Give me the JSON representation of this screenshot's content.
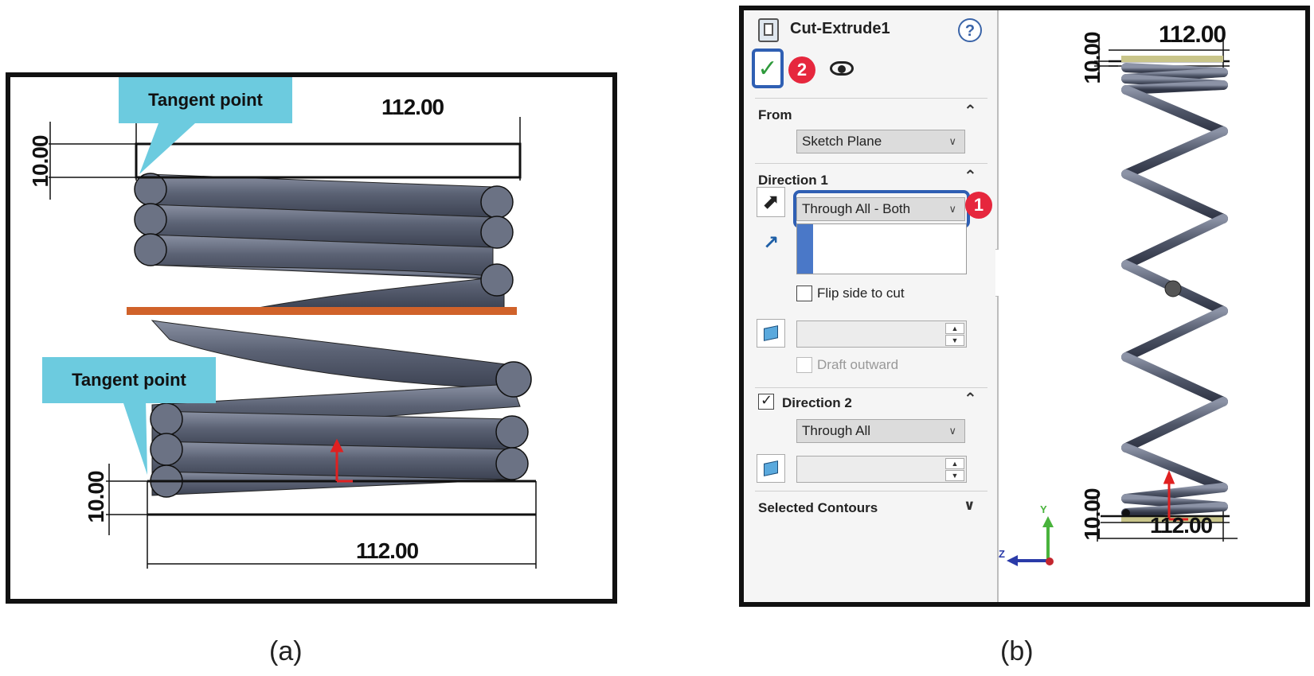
{
  "panel_a": {
    "callout_top": "Tangent point",
    "callout_bottom": "Tangent point",
    "dim_top_horizontal": "112.00",
    "dim_top_vertical": "10.00",
    "dim_bottom_horizontal": "112.00",
    "dim_bottom_vertical": "10.00",
    "caption": "(a)",
    "colors": {
      "callout": "#6ccbdf",
      "spring": "#5b6274",
      "cut_line": "#d0622a",
      "axis": "#e02020"
    }
  },
  "panel_b": {
    "caption": "(b)",
    "property_manager": {
      "title": "Cut-Extrude1",
      "help_icon": "?",
      "ok_icon": "✓",
      "badge_1": "1",
      "badge_2": "2",
      "from": {
        "label": "From",
        "value": "Sketch Plane"
      },
      "direction1": {
        "label": "Direction 1",
        "end_condition": "Through All - Both",
        "flip_side_label": "Flip side to cut",
        "flip_side_checked": false,
        "draft_outward_label": "Draft outward",
        "draft_outward_enabled": false
      },
      "direction2": {
        "label": "Direction 2",
        "checked": true,
        "end_condition": "Through All"
      },
      "selected_contours": {
        "label": "Selected Contours"
      }
    },
    "viewport": {
      "dim_top_horizontal": "112.00",
      "dim_top_vertical": "10.00",
      "dim_bottom_horizontal": "112.00",
      "dim_bottom_vertical": "10.00",
      "triad": {
        "y_label": "Y",
        "z_label": "Z"
      }
    }
  }
}
